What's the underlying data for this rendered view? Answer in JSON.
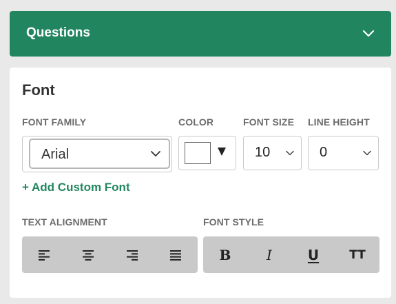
{
  "accordion": {
    "title": "Questions",
    "chevron_icon": "chevron-down-icon",
    "header_color": "#218660"
  },
  "panel": {
    "title": "Font",
    "font_family": {
      "label": "FONT FAMILY",
      "value": "Arial"
    },
    "color": {
      "label": "COLOR",
      "value": "#ffffff"
    },
    "font_size": {
      "label": "FONT SIZE",
      "value": "10"
    },
    "line_height": {
      "label": "LINE HEIGHT",
      "value": "0"
    },
    "add_custom_font": "+ Add Custom Font",
    "text_alignment": {
      "label": "TEXT ALIGNMENT",
      "buttons": [
        "align-left-icon",
        "align-center-icon",
        "align-right-icon",
        "align-justify-icon"
      ]
    },
    "font_style": {
      "label": "FONT STYLE",
      "bold": "B",
      "italic": "I",
      "underline": "U",
      "uppercase": "TT"
    }
  }
}
